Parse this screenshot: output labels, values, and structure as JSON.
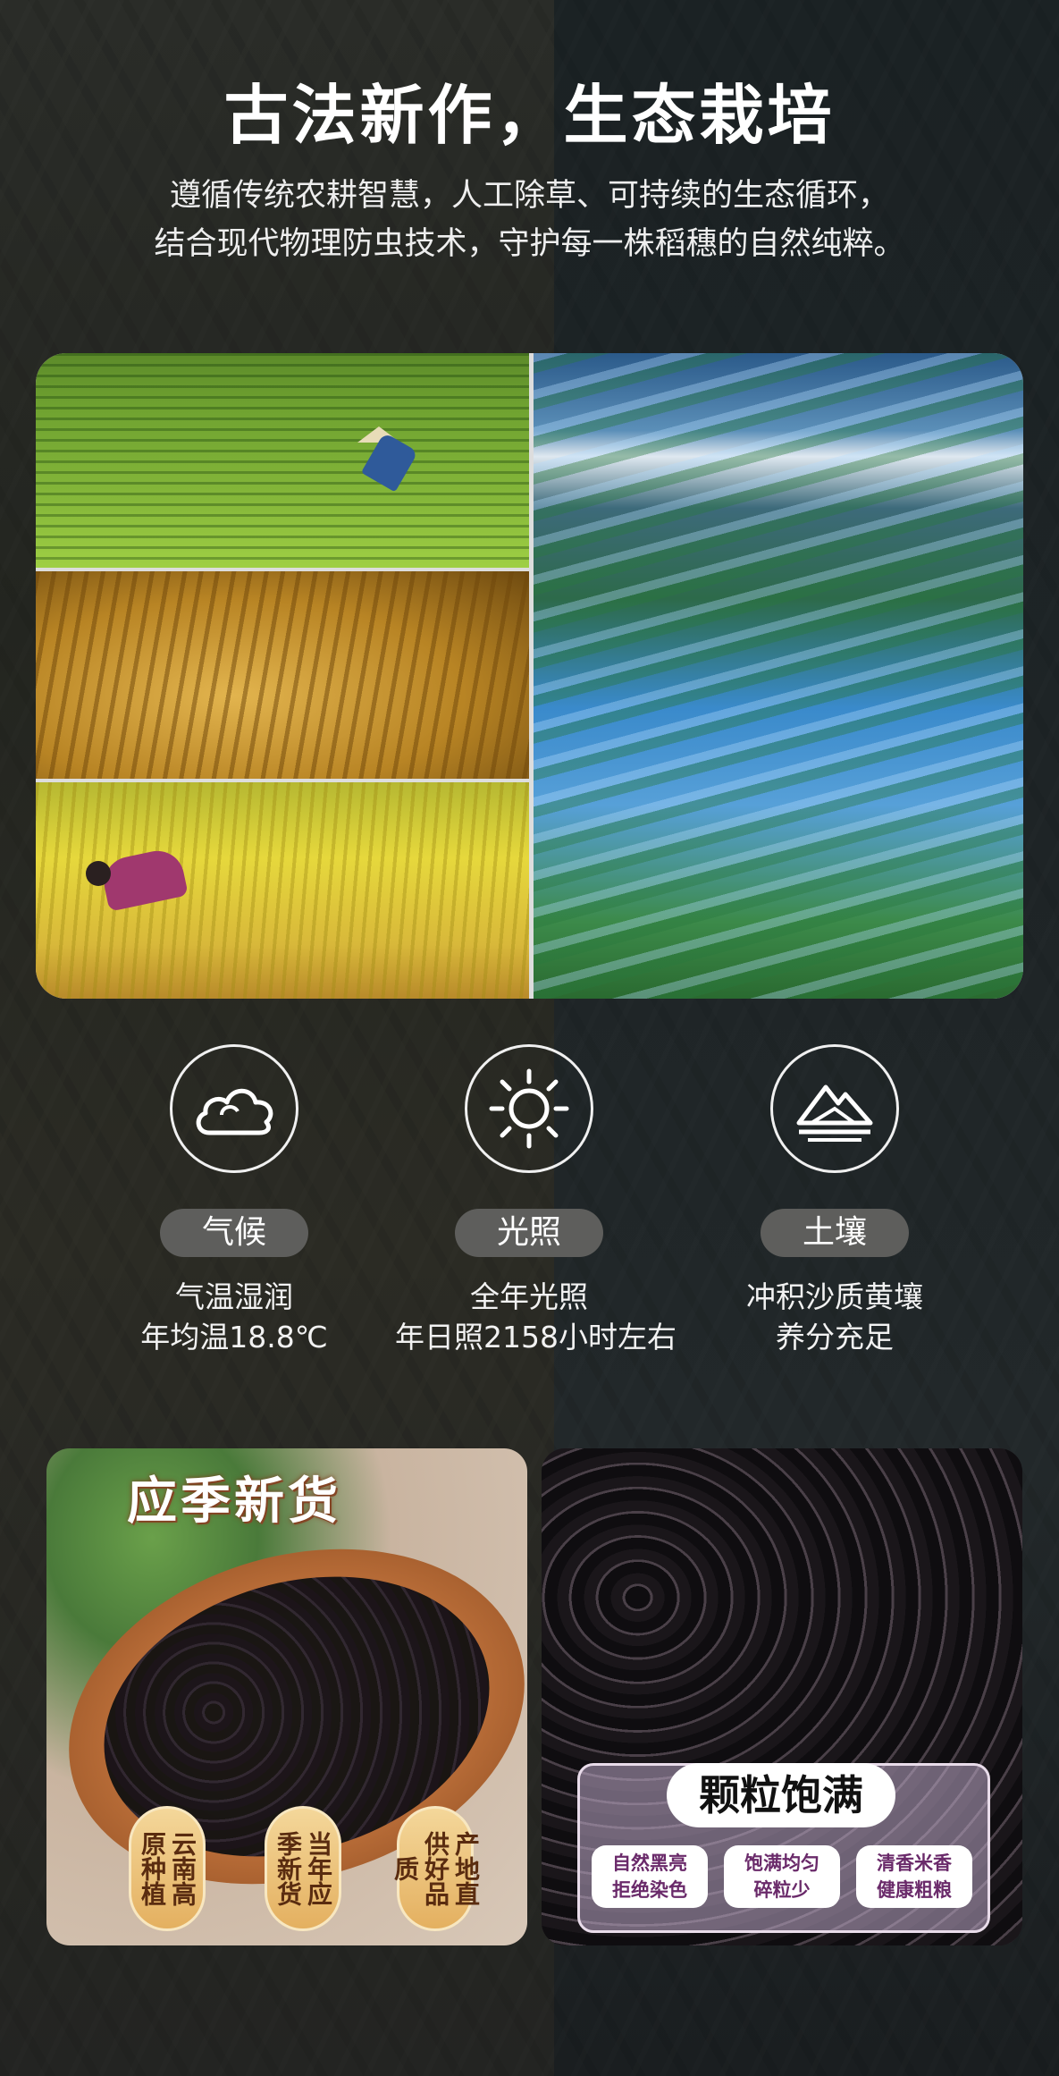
{
  "header": {
    "title": "古法新作，生态栽培",
    "subtitle_line1": "遵循传统农耕智慧，人工除草、可持续的生态循环，",
    "subtitle_line2": "结合现代物理防虫技术，守护每一株稻穗的自然纯粹。"
  },
  "photos": [
    "farmer-in-green-field",
    "golden-rice-ears",
    "harvest-yellow-field",
    "rice-terraces"
  ],
  "features": [
    {
      "icon": "cloud-icon",
      "label": "气候",
      "line1": "气温湿润",
      "line2": "年均温18.8℃"
    },
    {
      "icon": "sun-icon",
      "label": "光照",
      "line1": "全年光照",
      "line2": "年日照2158小时左右"
    },
    {
      "icon": "mountain-icon",
      "label": "土壤",
      "line1": "冲积沙质黄壤",
      "line2": "养分充足"
    }
  ],
  "product_left": {
    "headline": "应季新货",
    "badges": [
      "云南高原种植",
      "当年应季新货",
      "产地直供好品质"
    ]
  },
  "product_right": {
    "tag": "颗粒饱满",
    "subs": [
      {
        "line1": "自然黑亮",
        "line2": "拒绝染色"
      },
      {
        "line1": "饱满均匀",
        "line2": "碎粒少"
      },
      {
        "line1": "清香米香",
        "line2": "健康粗粮"
      }
    ]
  },
  "colors": {
    "background": "#1f2322",
    "pill": "#5e5e5c",
    "badge": "#e4b060",
    "text": "#ffffff"
  }
}
